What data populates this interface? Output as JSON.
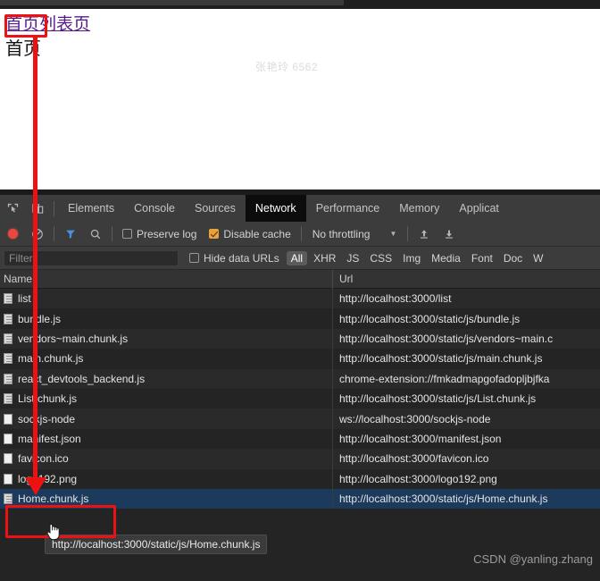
{
  "page": {
    "nav_links": [
      {
        "label": "首页",
        "name": "home-link"
      },
      {
        "label": "列表页",
        "name": "list-link"
      }
    ],
    "heading": "首页",
    "watermark_center": "张艳玲 6562"
  },
  "devtools": {
    "icons": {
      "inspect": "inspect-element-icon",
      "device": "device-toolbar-icon",
      "record": "record-icon",
      "clear": "clear-icon",
      "filter": "filter-funnel-icon",
      "search": "search-icon",
      "import": "import-har-icon",
      "export": "export-har-icon"
    },
    "tabs": [
      {
        "label": "Elements",
        "active": false
      },
      {
        "label": "Console",
        "active": false
      },
      {
        "label": "Sources",
        "active": false
      },
      {
        "label": "Network",
        "active": true
      },
      {
        "label": "Performance",
        "active": false
      },
      {
        "label": "Memory",
        "active": false
      },
      {
        "label": "Applicat",
        "active": false
      }
    ],
    "controls": {
      "preserve_log_label": "Preserve log",
      "preserve_log_checked": false,
      "disable_cache_label": "Disable cache",
      "disable_cache_checked": true,
      "throttling_value": "No throttling"
    },
    "filter": {
      "placeholder": "Filter",
      "value": "",
      "hide_data_urls_label": "Hide data URLs",
      "hide_data_urls_checked": false,
      "types": [
        {
          "label": "All",
          "selected": true
        },
        {
          "label": "XHR",
          "selected": false
        },
        {
          "label": "JS",
          "selected": false
        },
        {
          "label": "CSS",
          "selected": false
        },
        {
          "label": "Img",
          "selected": false
        },
        {
          "label": "Media",
          "selected": false
        },
        {
          "label": "Font",
          "selected": false
        },
        {
          "label": "Doc",
          "selected": false
        },
        {
          "label": "W",
          "selected": false
        }
      ]
    },
    "table": {
      "columns": {
        "name": "Name",
        "url": "Url"
      },
      "rows": [
        {
          "name": "list",
          "url": "http://localhost:3000/list",
          "icon": "doc",
          "selected": false
        },
        {
          "name": "bundle.js",
          "url": "http://localhost:3000/static/js/bundle.js",
          "icon": "doc",
          "selected": false
        },
        {
          "name": "vendors~main.chunk.js",
          "url": "http://localhost:3000/static/js/vendors~main.c",
          "icon": "doc",
          "selected": false
        },
        {
          "name": "main.chunk.js",
          "url": "http://localhost:3000/static/js/main.chunk.js",
          "icon": "doc",
          "selected": false
        },
        {
          "name": "react_devtools_backend.js",
          "url": "chrome-extension://fmkadmapgofadopljbjfka",
          "icon": "doc",
          "selected": false
        },
        {
          "name": "List.chunk.js",
          "url": "http://localhost:3000/static/js/List.chunk.js",
          "icon": "doc",
          "selected": false
        },
        {
          "name": "sockjs-node",
          "url": "ws://localhost:3000/sockjs-node",
          "icon": "plain",
          "selected": false
        },
        {
          "name": "manifest.json",
          "url": "http://localhost:3000/manifest.json",
          "icon": "plain",
          "selected": false
        },
        {
          "name": "favicon.ico",
          "url": "http://localhost:3000/favicon.ico",
          "icon": "plain",
          "selected": false
        },
        {
          "name": "logo192.png",
          "url": "http://localhost:3000/logo192.png",
          "icon": "plain",
          "selected": false
        },
        {
          "name": "Home.chunk.js",
          "url": "http://localhost:3000/static/js/Home.chunk.js",
          "icon": "doc",
          "selected": true
        }
      ]
    },
    "tooltip": "http://localhost:3000/static/js/Home.chunk.js"
  },
  "watermark_bottom_right": "CSDN @yanling.zhang",
  "colors": {
    "annotation": "#ee1111",
    "accent_record": "#e8483f",
    "checkbox_checked": "#e8a33d",
    "selected_row": "#1c3a5c",
    "link": "#551a8b"
  }
}
